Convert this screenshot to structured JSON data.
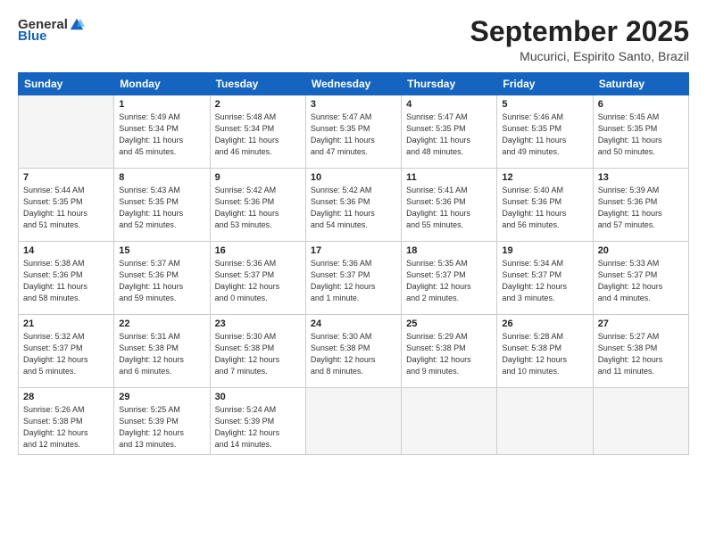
{
  "logo": {
    "general": "General",
    "blue": "Blue"
  },
  "header": {
    "month": "September 2025",
    "location": "Mucurici, Espirito Santo, Brazil"
  },
  "weekdays": [
    "Sunday",
    "Monday",
    "Tuesday",
    "Wednesday",
    "Thursday",
    "Friday",
    "Saturday"
  ],
  "weeks": [
    [
      {
        "day": "",
        "info": ""
      },
      {
        "day": "1",
        "info": "Sunrise: 5:49 AM\nSunset: 5:34 PM\nDaylight: 11 hours\nand 45 minutes."
      },
      {
        "day": "2",
        "info": "Sunrise: 5:48 AM\nSunset: 5:34 PM\nDaylight: 11 hours\nand 46 minutes."
      },
      {
        "day": "3",
        "info": "Sunrise: 5:47 AM\nSunset: 5:35 PM\nDaylight: 11 hours\nand 47 minutes."
      },
      {
        "day": "4",
        "info": "Sunrise: 5:47 AM\nSunset: 5:35 PM\nDaylight: 11 hours\nand 48 minutes."
      },
      {
        "day": "5",
        "info": "Sunrise: 5:46 AM\nSunset: 5:35 PM\nDaylight: 11 hours\nand 49 minutes."
      },
      {
        "day": "6",
        "info": "Sunrise: 5:45 AM\nSunset: 5:35 PM\nDaylight: 11 hours\nand 50 minutes."
      }
    ],
    [
      {
        "day": "7",
        "info": "Sunrise: 5:44 AM\nSunset: 5:35 PM\nDaylight: 11 hours\nand 51 minutes."
      },
      {
        "day": "8",
        "info": "Sunrise: 5:43 AM\nSunset: 5:35 PM\nDaylight: 11 hours\nand 52 minutes."
      },
      {
        "day": "9",
        "info": "Sunrise: 5:42 AM\nSunset: 5:36 PM\nDaylight: 11 hours\nand 53 minutes."
      },
      {
        "day": "10",
        "info": "Sunrise: 5:42 AM\nSunset: 5:36 PM\nDaylight: 11 hours\nand 54 minutes."
      },
      {
        "day": "11",
        "info": "Sunrise: 5:41 AM\nSunset: 5:36 PM\nDaylight: 11 hours\nand 55 minutes."
      },
      {
        "day": "12",
        "info": "Sunrise: 5:40 AM\nSunset: 5:36 PM\nDaylight: 11 hours\nand 56 minutes."
      },
      {
        "day": "13",
        "info": "Sunrise: 5:39 AM\nSunset: 5:36 PM\nDaylight: 11 hours\nand 57 minutes."
      }
    ],
    [
      {
        "day": "14",
        "info": "Sunrise: 5:38 AM\nSunset: 5:36 PM\nDaylight: 11 hours\nand 58 minutes."
      },
      {
        "day": "15",
        "info": "Sunrise: 5:37 AM\nSunset: 5:36 PM\nDaylight: 11 hours\nand 59 minutes."
      },
      {
        "day": "16",
        "info": "Sunrise: 5:36 AM\nSunset: 5:37 PM\nDaylight: 12 hours\nand 0 minutes."
      },
      {
        "day": "17",
        "info": "Sunrise: 5:36 AM\nSunset: 5:37 PM\nDaylight: 12 hours\nand 1 minute."
      },
      {
        "day": "18",
        "info": "Sunrise: 5:35 AM\nSunset: 5:37 PM\nDaylight: 12 hours\nand 2 minutes."
      },
      {
        "day": "19",
        "info": "Sunrise: 5:34 AM\nSunset: 5:37 PM\nDaylight: 12 hours\nand 3 minutes."
      },
      {
        "day": "20",
        "info": "Sunrise: 5:33 AM\nSunset: 5:37 PM\nDaylight: 12 hours\nand 4 minutes."
      }
    ],
    [
      {
        "day": "21",
        "info": "Sunrise: 5:32 AM\nSunset: 5:37 PM\nDaylight: 12 hours\nand 5 minutes."
      },
      {
        "day": "22",
        "info": "Sunrise: 5:31 AM\nSunset: 5:38 PM\nDaylight: 12 hours\nand 6 minutes."
      },
      {
        "day": "23",
        "info": "Sunrise: 5:30 AM\nSunset: 5:38 PM\nDaylight: 12 hours\nand 7 minutes."
      },
      {
        "day": "24",
        "info": "Sunrise: 5:30 AM\nSunset: 5:38 PM\nDaylight: 12 hours\nand 8 minutes."
      },
      {
        "day": "25",
        "info": "Sunrise: 5:29 AM\nSunset: 5:38 PM\nDaylight: 12 hours\nand 9 minutes."
      },
      {
        "day": "26",
        "info": "Sunrise: 5:28 AM\nSunset: 5:38 PM\nDaylight: 12 hours\nand 10 minutes."
      },
      {
        "day": "27",
        "info": "Sunrise: 5:27 AM\nSunset: 5:38 PM\nDaylight: 12 hours\nand 11 minutes."
      }
    ],
    [
      {
        "day": "28",
        "info": "Sunrise: 5:26 AM\nSunset: 5:38 PM\nDaylight: 12 hours\nand 12 minutes."
      },
      {
        "day": "29",
        "info": "Sunrise: 5:25 AM\nSunset: 5:39 PM\nDaylight: 12 hours\nand 13 minutes."
      },
      {
        "day": "30",
        "info": "Sunrise: 5:24 AM\nSunset: 5:39 PM\nDaylight: 12 hours\nand 14 minutes."
      },
      {
        "day": "",
        "info": ""
      },
      {
        "day": "",
        "info": ""
      },
      {
        "day": "",
        "info": ""
      },
      {
        "day": "",
        "info": ""
      }
    ]
  ]
}
